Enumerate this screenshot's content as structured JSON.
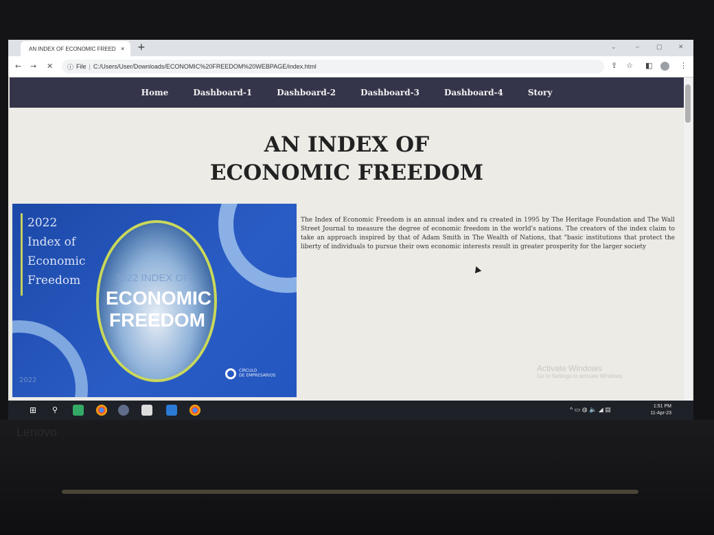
{
  "device": {
    "brand": "Lenovo"
  },
  "browser": {
    "tab_title": "AN INDEX OF ECONOMIC FREED",
    "tab_close": "×",
    "new_tab": "+",
    "address_prefix": "File",
    "url": "C:/Users/User/Downloads/ECONOMIC%20FREEDOM%20WEBPAGE/index.html",
    "icons": [
      "back-icon",
      "forward-icon",
      "stop-icon",
      "info-icon",
      "share-icon",
      "star-icon",
      "sidebar-icon",
      "profile-icon",
      "menu-icon"
    ]
  },
  "page": {
    "nav": [
      "Home",
      "Dashboard-1",
      "Dashboard-2",
      "Dashboard-3",
      "Dashboard-4",
      "Story"
    ],
    "title_line1": "AN INDEX OF",
    "title_line2": "ECONOMIC FREEDOM",
    "intro": "The Index of Economic Freedom is an annual index and ra created in 1995 by The Heritage Foundation and The Wall Street Journal to measure the degree of economic freedom in the world's nations. The creators of the index claim to take an approach inspired by that of Adam Smith in The Wealth of Nations, that \"basic institutions that protect the liberty of individuals to pursue their own economic interests result in greater prosperity for the larger society",
    "hero": {
      "left_title": [
        "2022",
        "Index of",
        "Economic",
        "Freedom"
      ],
      "globe_small": "2022 INDEX OF",
      "globe_big_1": "ECONOMIC",
      "globe_big_2": "FREEDOM",
      "year_footer": "2022",
      "logo_line1": "CÍRCULO",
      "logo_line2": "DE EMPRESARIOS"
    }
  },
  "os": {
    "watermark_title": "Activate Windows",
    "watermark_sub": "Go to Settings to activate Windows.",
    "time": "1:51 PM",
    "date": "11-Apr-23"
  }
}
